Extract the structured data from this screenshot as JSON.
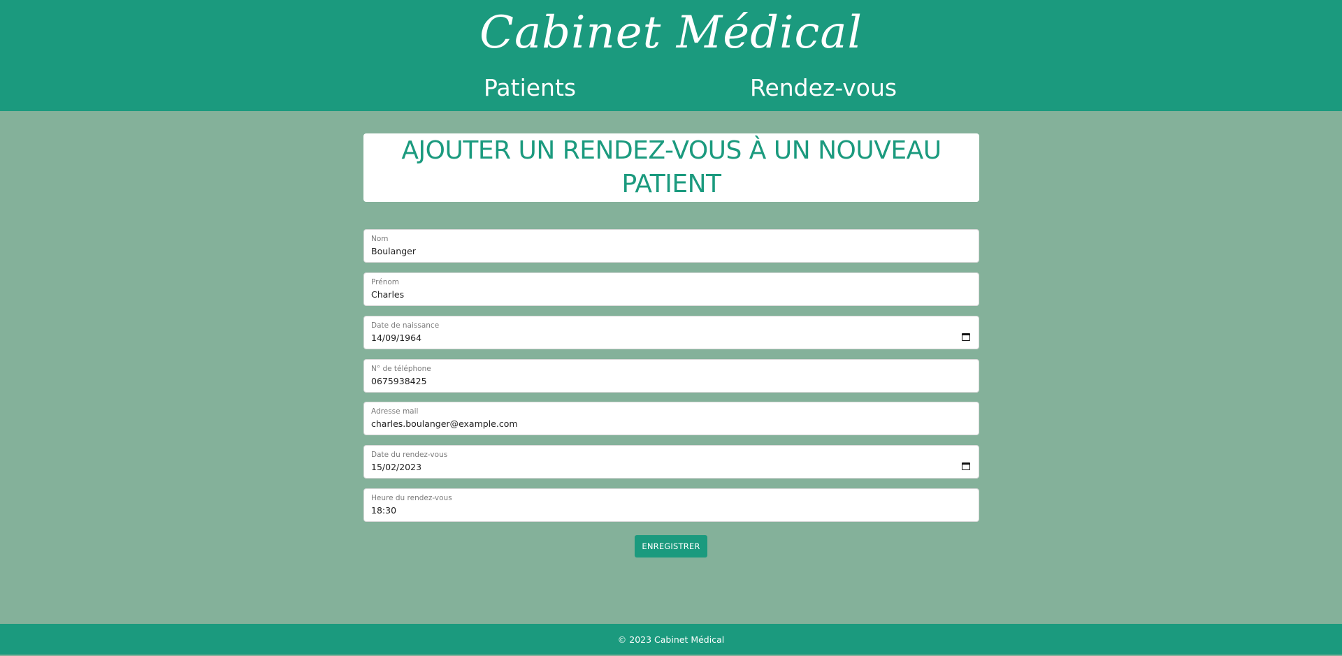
{
  "header": {
    "site_title": "Cabinet Médical",
    "nav": [
      {
        "label": "Patients"
      },
      {
        "label": "Rendez-vous"
      }
    ]
  },
  "main": {
    "page_title": "AJOUTER UN RENDEZ-VOUS À UN NOUVEAU PATIENT",
    "fields": [
      {
        "label": "Nom",
        "value": "Boulanger",
        "type": "text"
      },
      {
        "label": "Prénom",
        "value": "Charles",
        "type": "text"
      },
      {
        "label": "Date de naissance",
        "value": "14/09/1964",
        "type": "date",
        "icon": "calendar-icon"
      },
      {
        "label": "N° de téléphone",
        "value": "0675938425",
        "type": "tel"
      },
      {
        "label": "Adresse mail",
        "value": "charles.boulanger@example.com",
        "type": "email"
      },
      {
        "label": "Date du rendez-vous",
        "value": "15/02/2023",
        "type": "date",
        "icon": "calendar-icon"
      },
      {
        "label": "Heure du rendez-vous",
        "value": "18:30",
        "type": "time"
      }
    ],
    "submit_label": "ENREGISTRER"
  },
  "footer": {
    "text": "© 2023 Cabinet Médical"
  },
  "colors": {
    "primary": "#1b9a7e",
    "background": "#84b19a",
    "card": "#ffffff"
  }
}
